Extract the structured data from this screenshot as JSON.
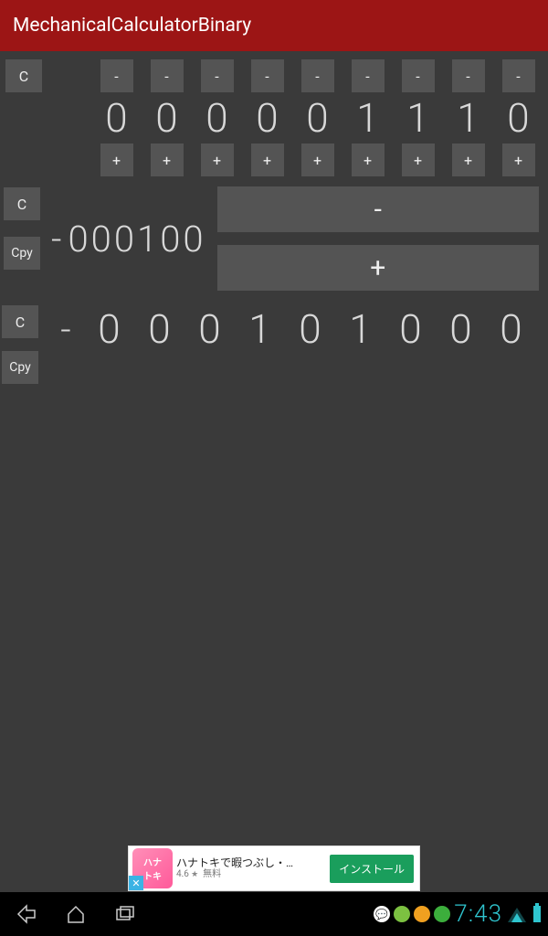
{
  "titlebar": {
    "title": "MechanicalCalculatorBinary"
  },
  "bits": {
    "clear_label": "C",
    "minus_labels": [
      "-",
      "-",
      "-",
      "-",
      "-",
      "-",
      "-",
      "-",
      "-"
    ],
    "digits": [
      "0",
      "0",
      "0",
      "0",
      "0",
      "1",
      "1",
      "1",
      "0"
    ],
    "plus_labels": [
      "+",
      "+",
      "+",
      "+",
      "+",
      "+",
      "+",
      "+",
      "+"
    ]
  },
  "counter": {
    "clear_label": "C",
    "copy_label": "Cpy",
    "sign": "-",
    "value": "000100",
    "subtract_label": "-",
    "add_label": "+"
  },
  "result": {
    "clear_label": "C",
    "copy_label": "Cpy",
    "sign": "-",
    "digits": [
      "0",
      "0",
      "0",
      "1",
      "0",
      "1",
      "0",
      "0",
      "0"
    ]
  },
  "ad": {
    "logo_line1": "ハナ",
    "logo_line2": "トキ",
    "title": "ハナトキで暇つぶし・…",
    "rating": "4.6",
    "price": "無料",
    "cta": "インストール",
    "close": "✕"
  },
  "status": {
    "time": "7:43"
  }
}
